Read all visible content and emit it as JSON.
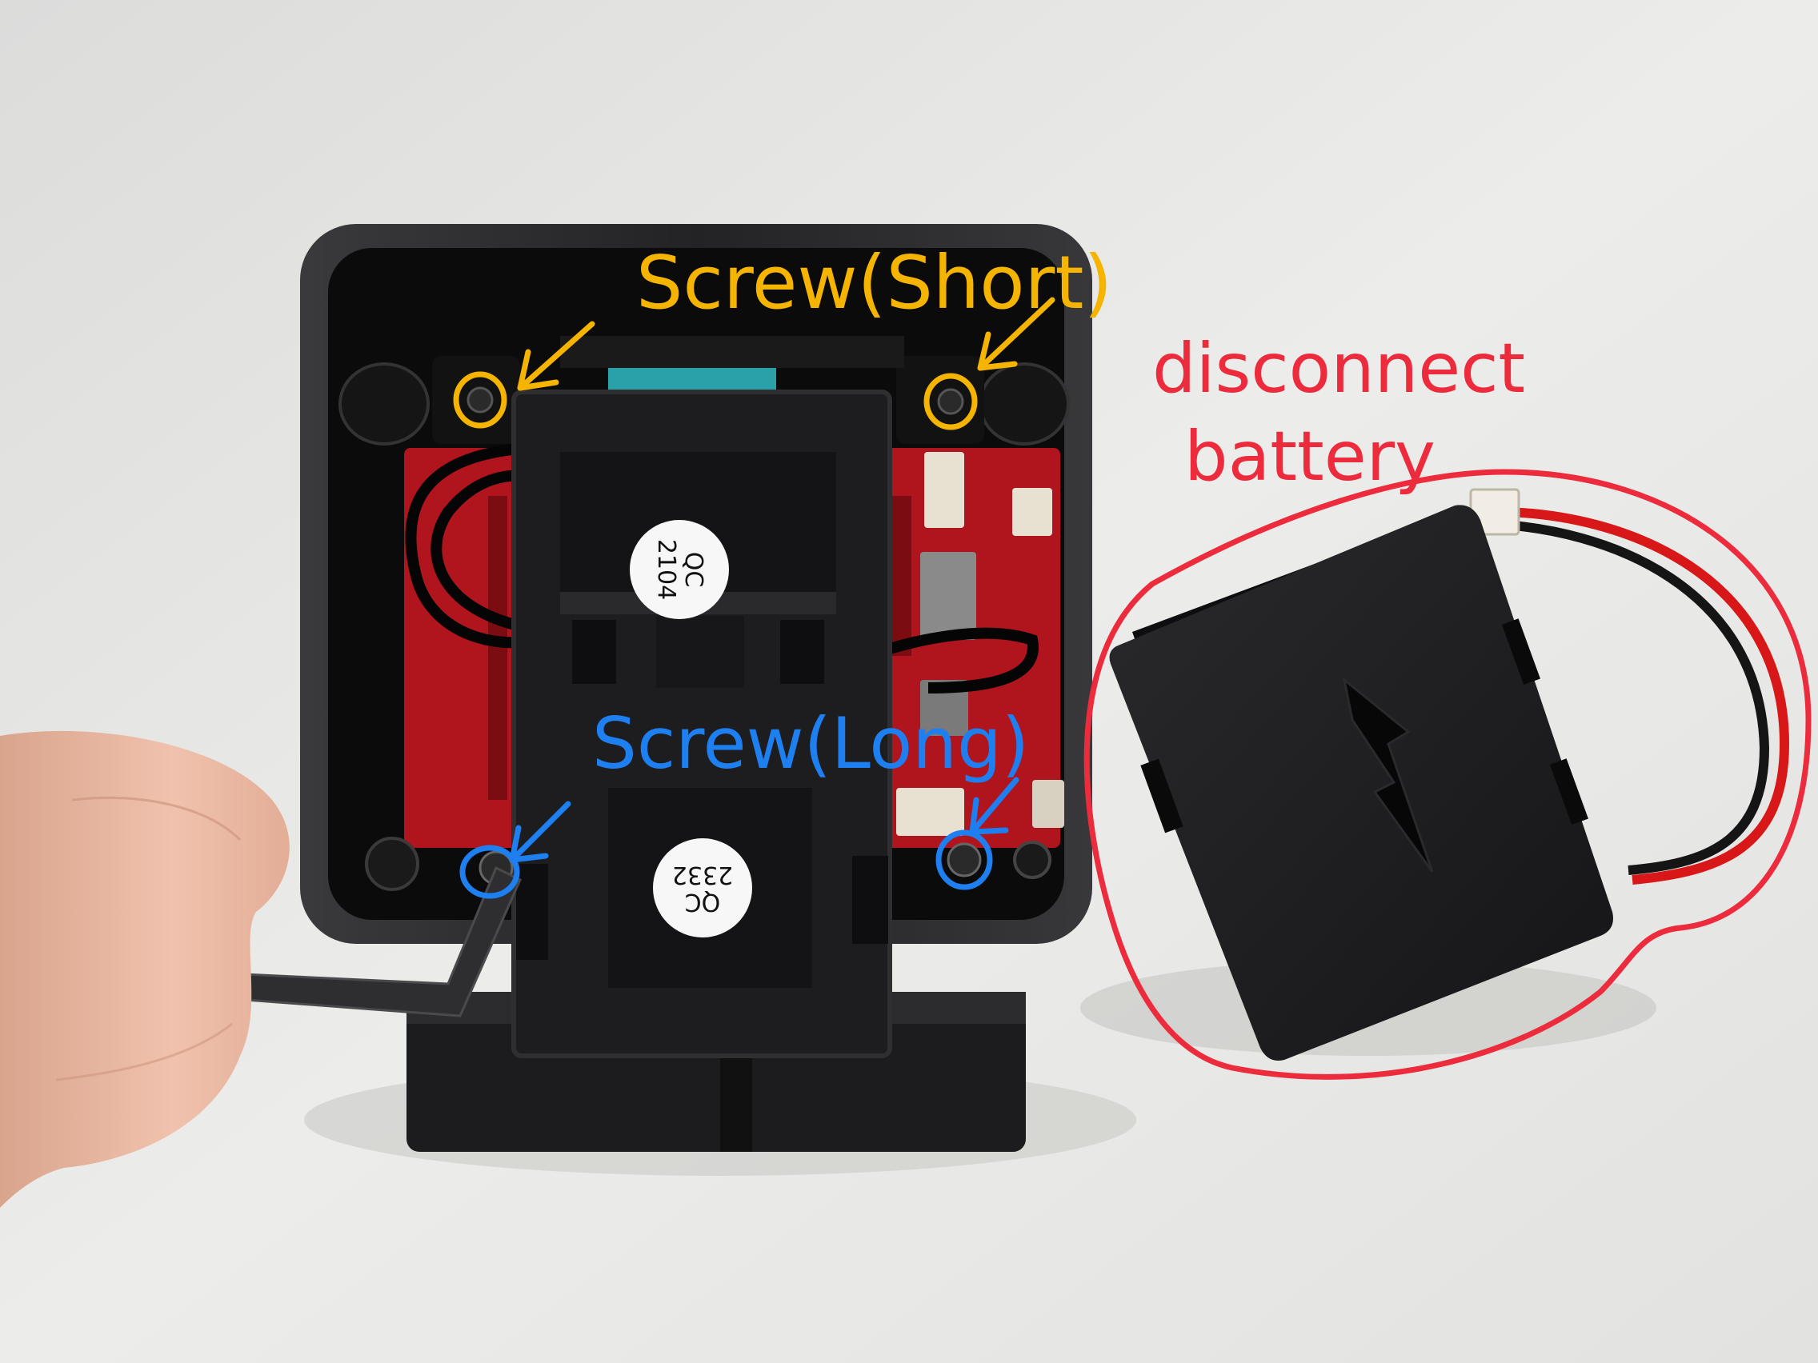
{
  "annotations": {
    "screw_short": {
      "label": "Screw(Short)",
      "color": "#f5b400"
    },
    "screw_long": {
      "label": "Screw(Long)",
      "color": "#1e7ff0"
    },
    "battery_note": {
      "line1": "disconnect",
      "line2": "battery",
      "color": "#ec2c3c"
    }
  },
  "servo_labels": {
    "top": {
      "line1": "QC",
      "line2": "2104"
    },
    "bottom": {
      "line1": "QC",
      "line2": "2332"
    }
  },
  "colors": {
    "background": "#e4e4e2",
    "device_shell": "#2a2a2c",
    "device_inner": "#0b0b0c",
    "board": "#b0151e",
    "battery": "#1e1e20",
    "wire_red": "#d81818",
    "wire_black": "#151515",
    "skin": "#e9b6a0"
  },
  "icons": [
    "lightning-bolt-icon",
    "arrow-icon",
    "screw-hole-icon"
  ]
}
